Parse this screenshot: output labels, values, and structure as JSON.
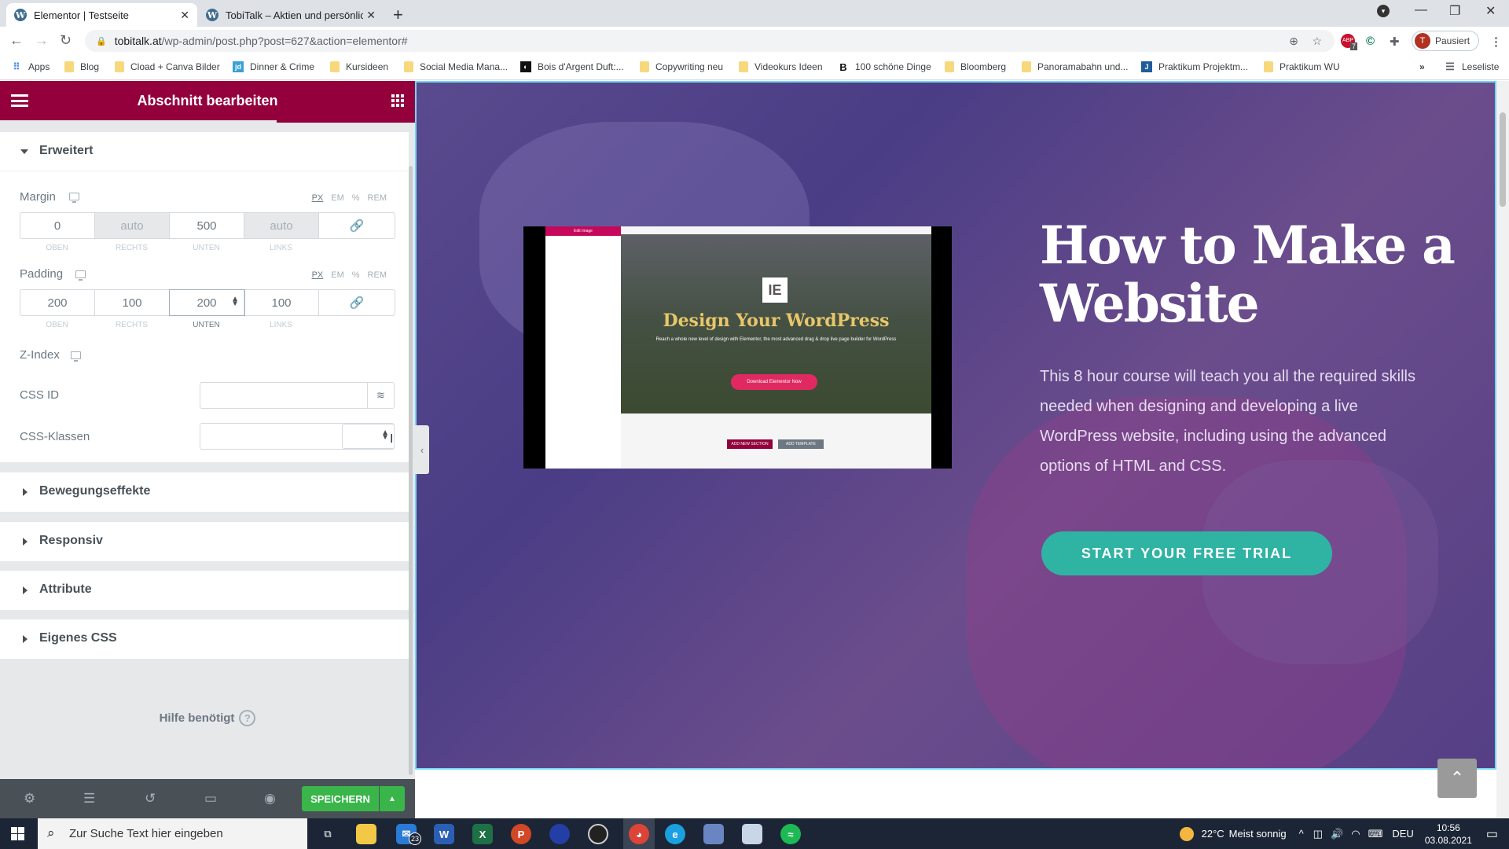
{
  "browser": {
    "tabs": [
      {
        "title": "Elementor | Testseite",
        "active": true
      },
      {
        "title": "TobiTalk – Aktien und persönliche",
        "active": false
      }
    ],
    "url_host": "tobitalk.at",
    "url_path": "/wp-admin/post.php?post=627&action=elementor#",
    "profile_status": "Pausiert",
    "profile_initial": "T",
    "adblock_count": "7",
    "bookmarks": [
      {
        "label": "Apps",
        "icon": "apps-grid-icon"
      },
      {
        "label": "Blog",
        "icon": "folder-icon"
      },
      {
        "label": "Cload + Canva Bilder",
        "icon": "folder-icon"
      },
      {
        "label": "Dinner & Crime",
        "icon": "jd-icon"
      },
      {
        "label": "Kursideen",
        "icon": "folder-icon"
      },
      {
        "label": "Social Media Mana...",
        "icon": "folder-icon"
      },
      {
        "label": "Bois d'Argent Duft:...",
        "icon": "site-icon"
      },
      {
        "label": "Copywriting neu",
        "icon": "folder-icon"
      },
      {
        "label": "Videokurs Ideen",
        "icon": "folder-icon"
      },
      {
        "label": "100 schöne Dinge",
        "icon": "b-icon"
      },
      {
        "label": "Bloomberg",
        "icon": "folder-icon"
      },
      {
        "label": "Panoramabahn und...",
        "icon": "folder-icon"
      },
      {
        "label": "Praktikum Projektm...",
        "icon": "j-icon"
      },
      {
        "label": "Praktikum WU",
        "icon": "folder-icon"
      }
    ],
    "reading_list": "Leseliste"
  },
  "panel": {
    "title": "Abschnitt bearbeiten",
    "section_open": "Erweitert",
    "margin": {
      "label": "Margin",
      "units": [
        "PX",
        "EM",
        "%",
        "REM"
      ],
      "active_unit": "PX",
      "values": [
        "0",
        "auto",
        "500",
        "auto"
      ],
      "sides": [
        "OBEN",
        "RECHTS",
        "UNTEN",
        "LINKS"
      ]
    },
    "padding": {
      "label": "Padding",
      "units": [
        "PX",
        "EM",
        "%",
        "REM"
      ],
      "active_unit": "PX",
      "values": [
        "200",
        "100",
        "200",
        "100"
      ],
      "sides": [
        "OBEN",
        "RECHTS",
        "UNTEN",
        "LINKS"
      ]
    },
    "z_index": {
      "label": "Z-Index",
      "value": ""
    },
    "css_id": {
      "label": "CSS ID",
      "value": ""
    },
    "css_classes": {
      "label": "CSS-Klassen",
      "value": ""
    },
    "collapsed_sections": [
      "Bewegungseffekte",
      "Responsiv",
      "Attribute",
      "Eigenes CSS"
    ],
    "help": "Hilfe benötigt",
    "save_label": "SPEICHERN"
  },
  "preview": {
    "heading": "How to Make a Website",
    "description": "This 8 hour course will teach you all the required skills needed when designing and developing a live WordPress website, including using the advanced options of HTML and CSS.",
    "cta": "START YOUR FREE TRIAL",
    "video": {
      "panel_title": "Edit Image",
      "title": "Design Your WordPress",
      "subtitle": "Reach a whole new level of design with Elementor, the most advanced drag & drop live page builder for WordPress",
      "button": "Download Elementor Now",
      "add_section": "ADD NEW SECTION",
      "add_template": "ADD TEMPLATE"
    }
  },
  "taskbar": {
    "search_placeholder": "Zur Suche Text hier eingeben",
    "mail_badge": "23",
    "weather": "22°C",
    "weather_text": "Meist sonnig",
    "language": "DEU",
    "time": "10:56",
    "date": "03.08.2021"
  }
}
